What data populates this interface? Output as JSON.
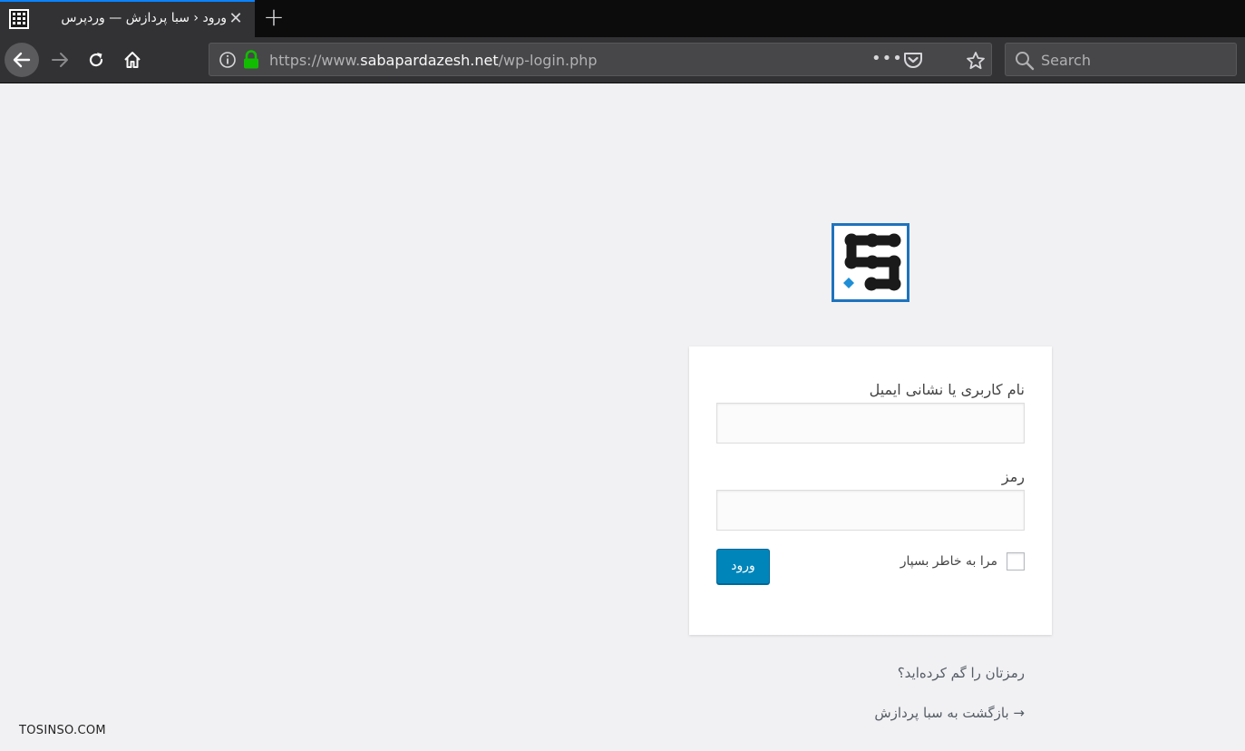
{
  "browser": {
    "tab": {
      "title": "ورود ‹ سبا پردازش — وردپرس",
      "close_glyph": "✕"
    },
    "new_tab_glyph": "+",
    "url": {
      "scheme": "https://www.",
      "host": "sabapardazesh.net",
      "path": "/wp-login.php"
    },
    "url_more_glyph": "•••",
    "search": {
      "placeholder": "Search"
    }
  },
  "login": {
    "username_label": "نام کاربری یا نشانی ایمیل",
    "username_value": "",
    "password_label": "رمز",
    "password_value": "",
    "remember_label": "مرا به خاطر بسپار",
    "remember_checked": false,
    "submit_label": "ورود",
    "lost_password": "رمزتان را گم کرده‌اید؟",
    "back_to_site": "→ بازگشت به سبا پردازش"
  },
  "colors": {
    "button": "#0085ba",
    "page_bg": "#f1f1f3",
    "logo_blue": "#1e73be",
    "tab_accent": "#0a84ff"
  },
  "watermark": "TOSINSO.COM"
}
